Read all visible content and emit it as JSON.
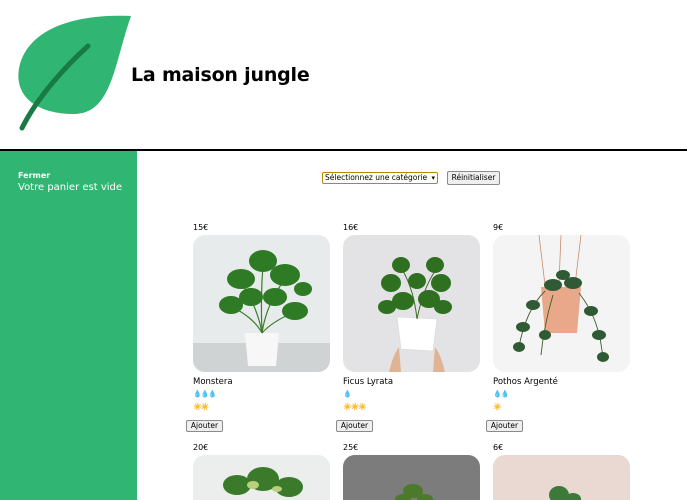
{
  "header": {
    "title": "La maison jungle",
    "logo_icon": "leaf-icon"
  },
  "sidebar": {
    "close_label": "Fermer",
    "cart_status": "Votre panier est vide"
  },
  "filter": {
    "selected": "Sélectionnez une catégorie",
    "reset_label": "Réinitialiser"
  },
  "products": [
    {
      "price": "15€",
      "name": "Monstera",
      "water": "💧💧💧",
      "sun": "☀️☀️",
      "add_label": "Ajouter"
    },
    {
      "price": "16€",
      "name": "Ficus Lyrata",
      "water": "💧",
      "sun": "☀️☀️☀️",
      "add_label": "Ajouter"
    },
    {
      "price": "9€",
      "name": "Pothos Argenté",
      "water": "💧💧",
      "sun": "☀️",
      "add_label": "Ajouter"
    },
    {
      "price": "20€"
    },
    {
      "price": "25€"
    },
    {
      "price": "6€"
    }
  ],
  "colors": {
    "brand_green": "#31b572",
    "leaf_dark": "#1a7a45"
  }
}
